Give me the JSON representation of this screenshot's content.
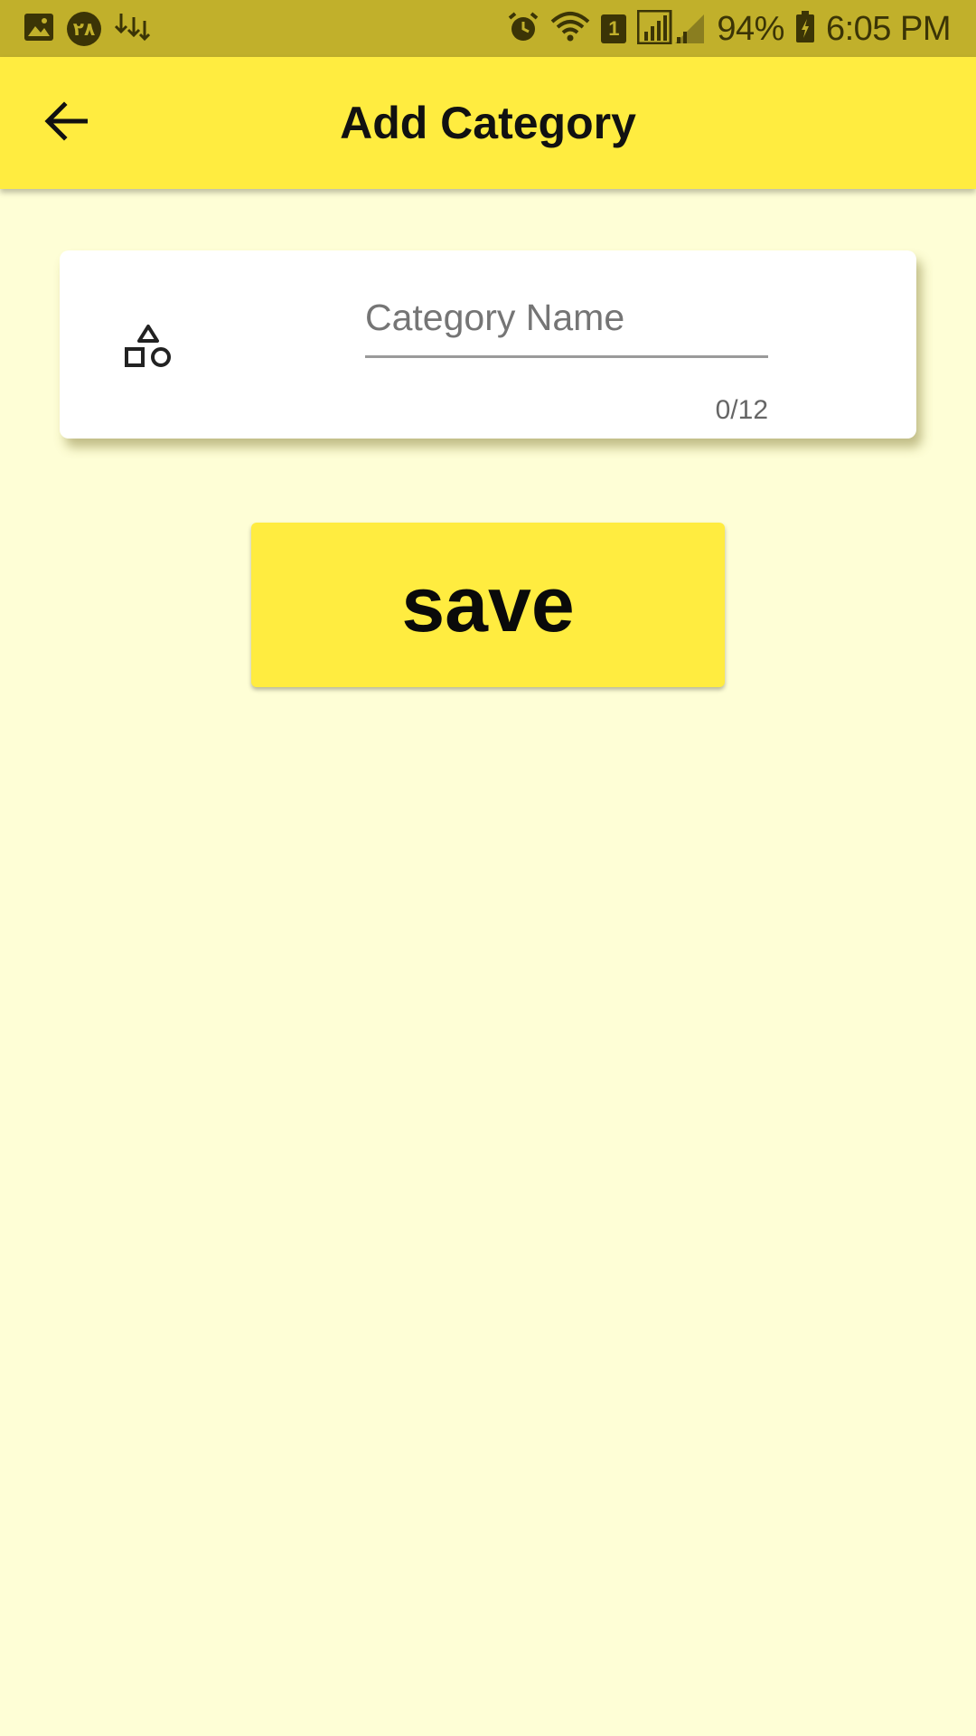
{
  "status_bar": {
    "date_badge": "۲۸",
    "sim_slot": "1",
    "battery": "94%",
    "time": "6:05 PM",
    "icons_left": [
      "image-icon",
      "date-badge",
      "download-icon"
    ],
    "icons_right": [
      "alarm-icon",
      "wifi-icon",
      "sim-icon",
      "signal-icon",
      "battery-icon"
    ]
  },
  "app_bar": {
    "title": "Add Category",
    "back_icon": "arrow-back-icon"
  },
  "form": {
    "category_icon": "category-shapes-icon",
    "name_placeholder": "Category Name",
    "name_value": "",
    "counter": "0/12"
  },
  "actions": {
    "save_label": "save"
  },
  "colors": {
    "status_bar_bg": "#c1b02b",
    "app_bar_bg": "#ffec40",
    "page_bg": "#fefed6",
    "card_bg": "#ffffff",
    "save_bg": "#ffec40"
  }
}
